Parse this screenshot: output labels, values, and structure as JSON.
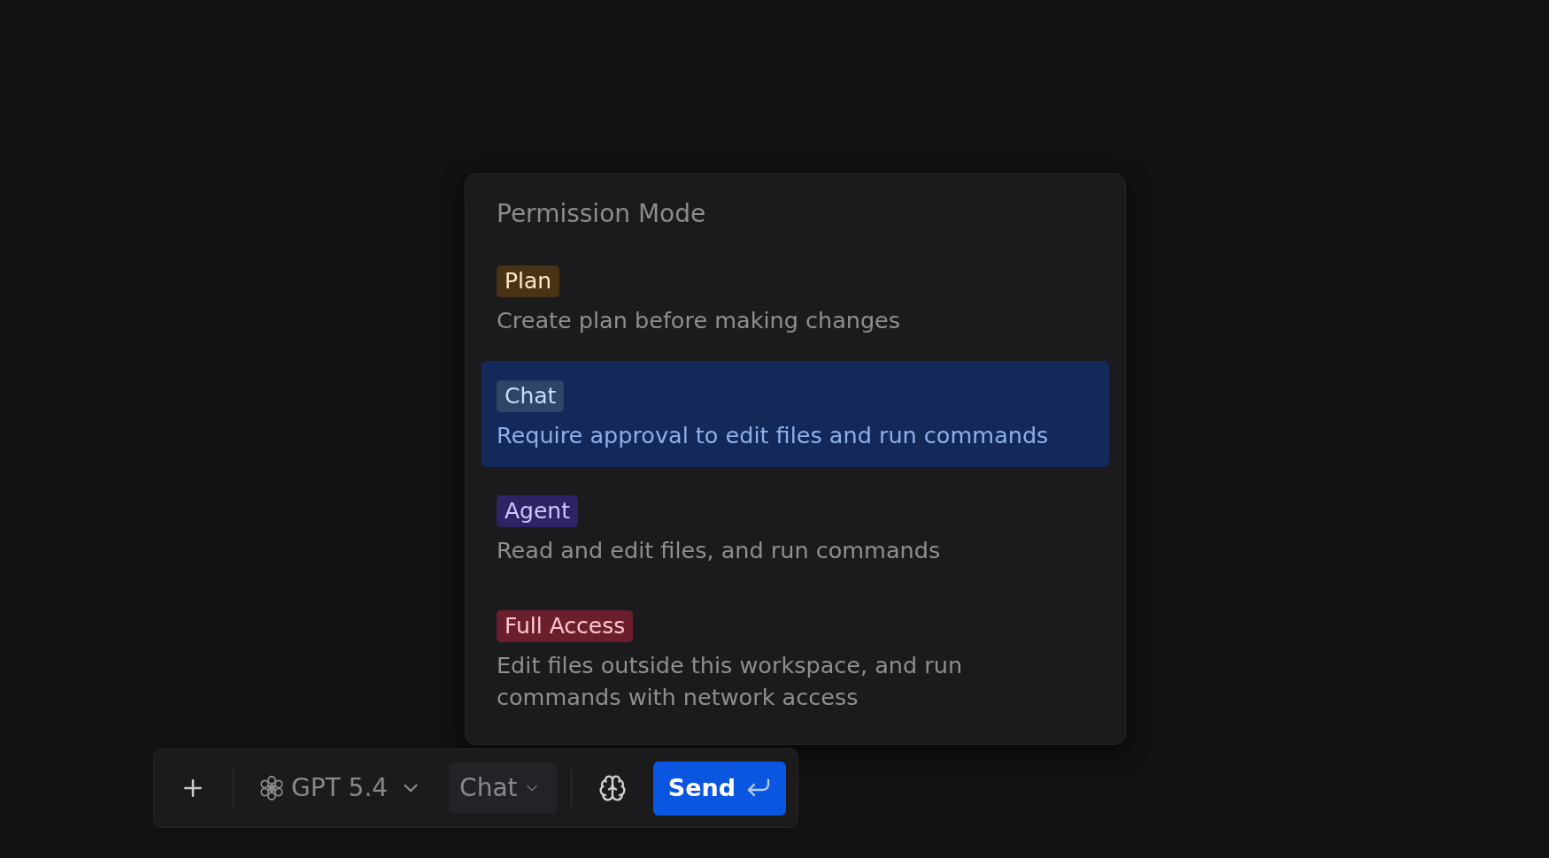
{
  "menu": {
    "title": "Permission Mode",
    "options": [
      {
        "label": "Plan",
        "description": "Create plan before making changes",
        "color": "#4a3314",
        "selected": false
      },
      {
        "label": "Chat",
        "description": "Require approval to edit files and run commands",
        "color": "#2d4567",
        "selected": true
      },
      {
        "label": "Agent",
        "description": "Read and edit files, and run commands",
        "color": "#2d2466",
        "selected": false
      },
      {
        "label": "Full Access",
        "description": "Edit files outside this workspace, and run commands with network access",
        "color": "#6b1f2c",
        "selected": false
      }
    ]
  },
  "composer": {
    "model": "GPT 5.4",
    "mode": "Chat",
    "send": "Send"
  }
}
